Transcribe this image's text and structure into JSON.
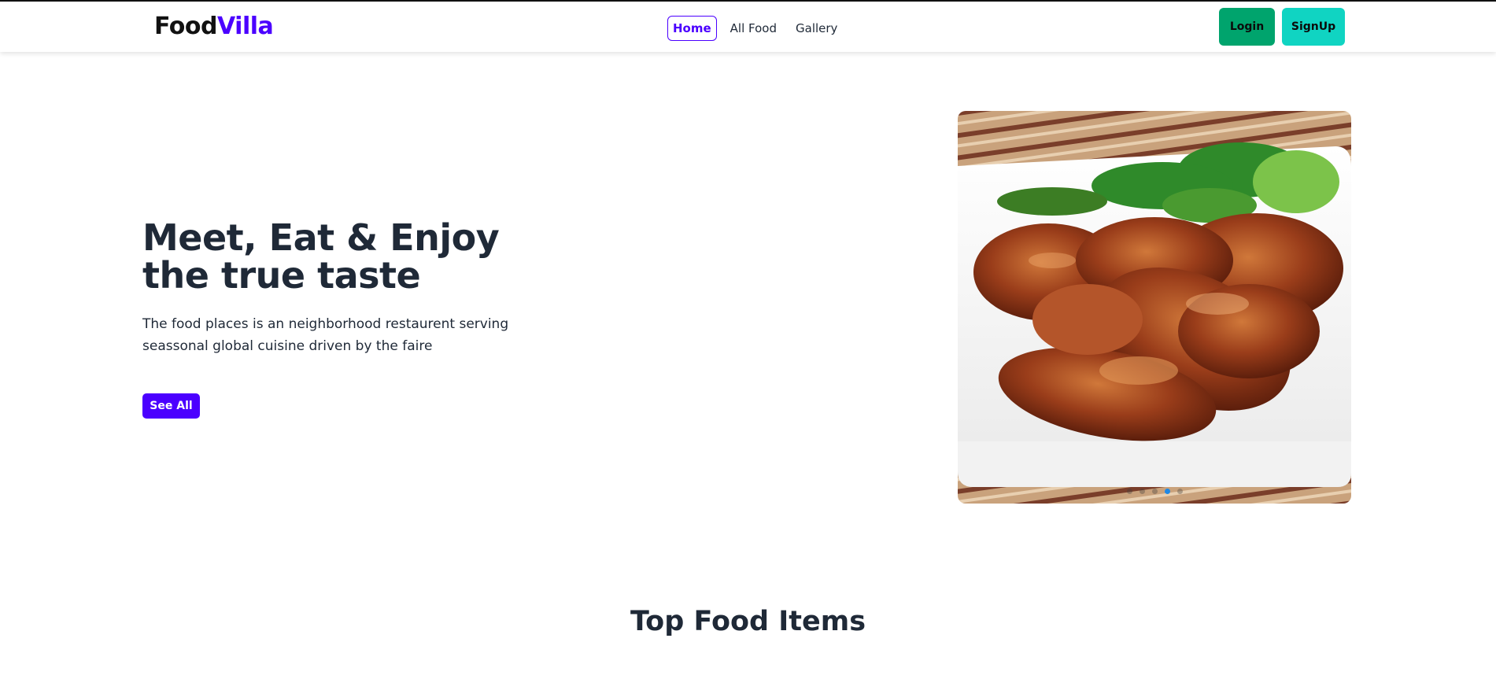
{
  "logo": {
    "part1": "Food",
    "part2": "Villa"
  },
  "nav": {
    "items": [
      {
        "label": "Home",
        "active": true
      },
      {
        "label": "All Food"
      },
      {
        "label": "Gallery"
      }
    ]
  },
  "auth": {
    "login_label": "Login",
    "signup_label": "SignUp"
  },
  "hero": {
    "title_line1": "Meet, Eat & Enjoy",
    "title_line2": "the true taste",
    "description_line1": "The food places is an neighborhood restaurent serving",
    "description_line2": "seassonal global cuisine driven by the faire",
    "cta_label": "See All"
  },
  "carousel": {
    "slide_count": 5,
    "active_index": 3
  },
  "section": {
    "title": "Top Food Items"
  },
  "colors": {
    "brand": "#4b00ff",
    "login_bg": "#00a46d",
    "signup_bg": "#10d4c2",
    "text": "#1f2937",
    "dot_active": "#1e88e5"
  }
}
